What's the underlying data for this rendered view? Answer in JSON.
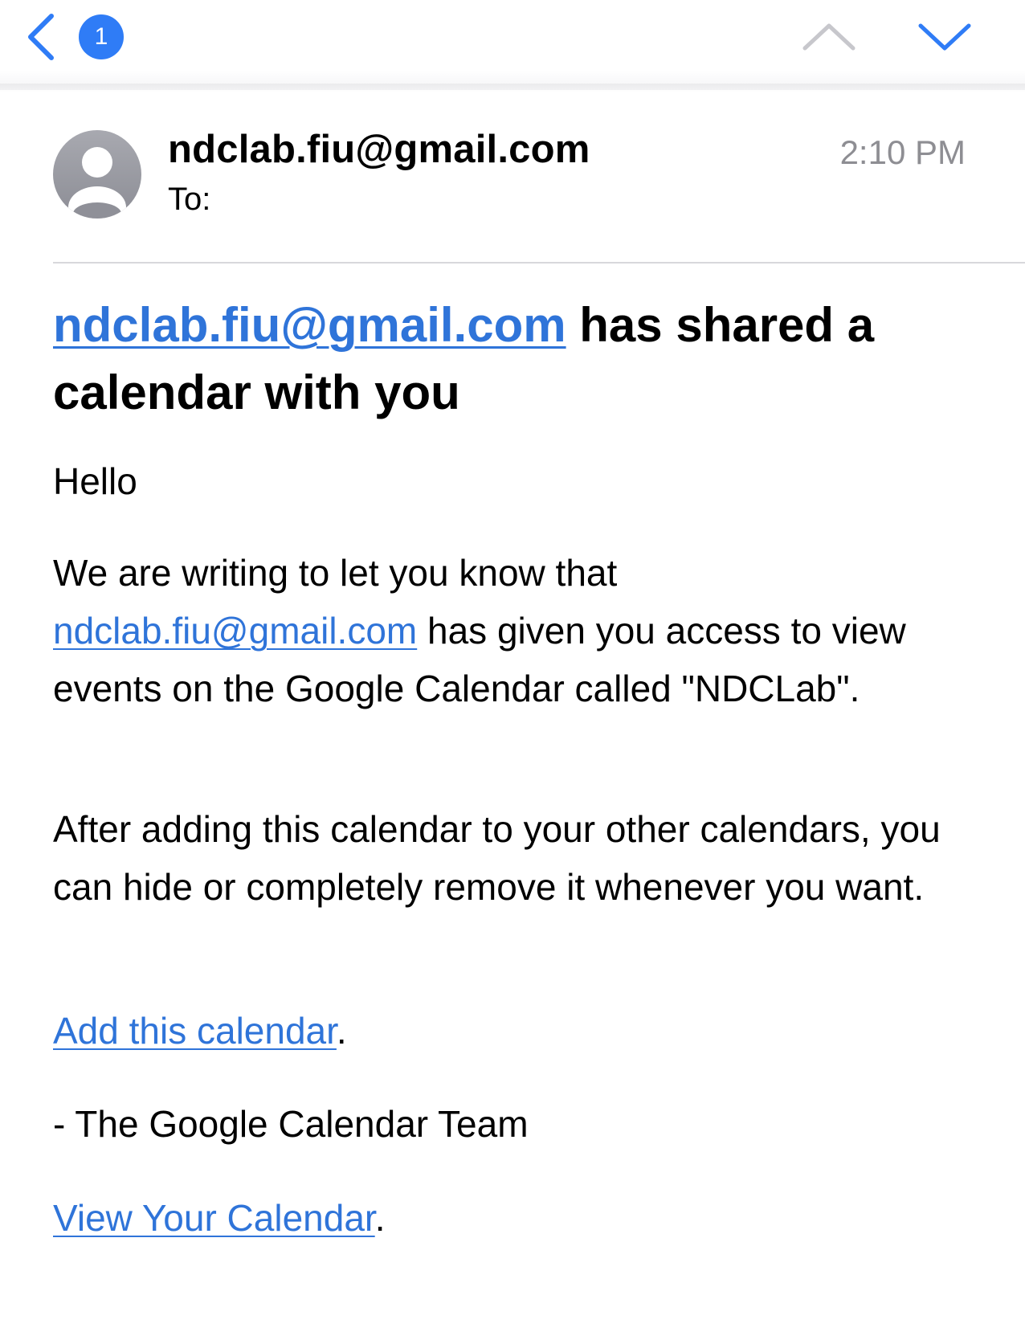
{
  "toolbar": {
    "unread_count": "1"
  },
  "message": {
    "sender": "ndclab.fiu@gmail.com",
    "to_label": "To:",
    "time": "2:10 PM"
  },
  "headline": {
    "link_text": "ndclab.fiu@gmail.com",
    "text": " has shared a calendar with you"
  },
  "body": {
    "greeting": "Hello",
    "p1_before": "We are writing to let you know that ",
    "p1_link": "ndclab.fiu@gmail.com",
    "p1_after": " has given you access to view events on the Google Calendar called \"NDCLab\".",
    "p2": "After adding this calendar to your other calendars, you can hide or completely remove it whenever you want.",
    "add_link": "Add this calendar",
    "add_suffix": ".",
    "signature": "- The Google Calendar Team",
    "view_link": "View Your Calendar",
    "view_suffix": "."
  },
  "colors": {
    "accent": "#2f74d9",
    "badge": "#2f7cf6",
    "secondary_text": "#8e8e93"
  }
}
